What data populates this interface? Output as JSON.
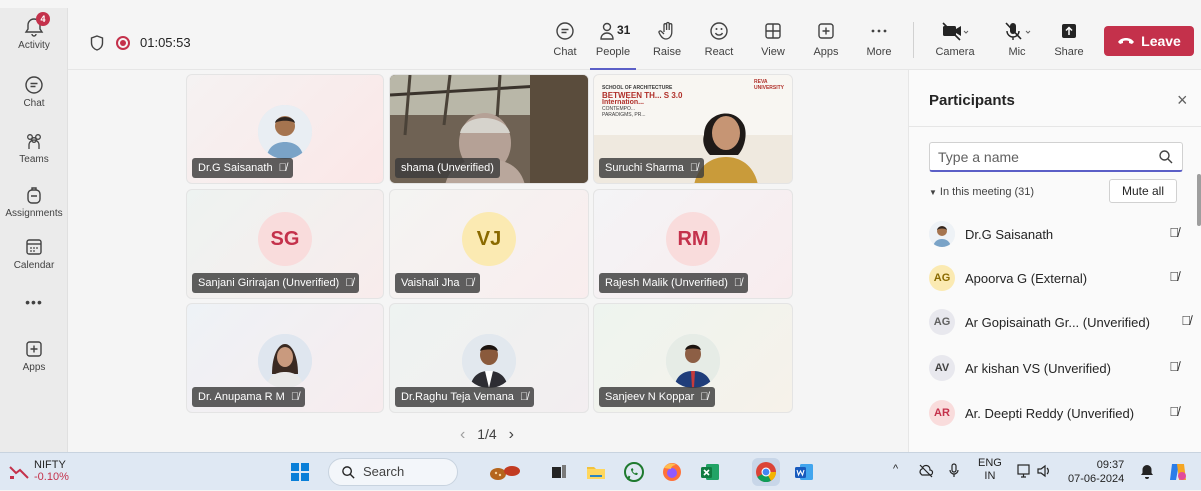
{
  "rail": {
    "activity": {
      "label": "Activity",
      "badge": "4"
    },
    "chat": "Chat",
    "teams": "Teams",
    "assignments": "Assignments",
    "calendar": "Calendar",
    "more": "•••",
    "apps": "Apps"
  },
  "meeting": {
    "timer": "01:05:53"
  },
  "toolbar": {
    "chat": "Chat",
    "people": "People",
    "people_count": "31",
    "raise": "Raise",
    "react": "React",
    "view": "View",
    "apps": "Apps",
    "more": "More",
    "camera": "Camera",
    "mic": "Mic",
    "share": "Share",
    "leave": "Leave"
  },
  "tiles": [
    {
      "name": "Dr.G Saisanath",
      "muted": true,
      "kind": "photo",
      "bg": "#f7e6e6"
    },
    {
      "name": "shama (Unverified)",
      "muted": false,
      "kind": "video"
    },
    {
      "name": "Suruchi Sharma",
      "muted": true,
      "kind": "video"
    },
    {
      "name": "Sanjani Girirajan (Unverified)",
      "muted": true,
      "kind": "initials",
      "initials": "SG",
      "color": "#c4314b",
      "avbg": "#f9dcdc"
    },
    {
      "name": "Vaishali Jha",
      "muted": true,
      "kind": "initials",
      "initials": "VJ",
      "color": "#8a6a00",
      "avbg": "#fbeab2"
    },
    {
      "name": "Rajesh Malik (Unverified)",
      "muted": true,
      "kind": "initials",
      "initials": "RM",
      "color": "#c4314b",
      "avbg": "#f9dcdc"
    },
    {
      "name": "Dr. Anupama R M",
      "muted": true,
      "kind": "photo"
    },
    {
      "name": "Dr.Raghu Teja Vemana",
      "muted": true,
      "kind": "photo"
    },
    {
      "name": "Sanjeev N Koppar",
      "muted": true,
      "kind": "photo"
    }
  ],
  "slide_text": {
    "org": "REVA UNIVERSITY",
    "school": "SCHOOL OF ARCHITECTURE",
    "headline": "BETWEEN TH... S 3.0",
    "sub": "Internation...",
    "line3": "CONTEMPO...",
    "line4": "PARADIGMS, PR..."
  },
  "pager": {
    "prev": "‹",
    "label": "1/4",
    "next": "›"
  },
  "panel": {
    "title": "Participants",
    "close": "×",
    "search_placeholder": "Type a name",
    "in_meeting": "In this meeting (31)",
    "mute_all": "Mute all",
    "participants": [
      {
        "initials": "",
        "name": "Dr.G Saisanath",
        "photo": true
      },
      {
        "initials": "AG",
        "name": "Apoorva G (External)",
        "bg": "#fbeab2",
        "fg": "#8a6a00"
      },
      {
        "initials": "AG",
        "name": "Ar Gopisainath Gr...  (Unverified)",
        "bg": "#e8e8ee",
        "fg": "#616161"
      },
      {
        "initials": "AV",
        "name": "Ar kishan VS (Unverified)",
        "bg": "#e8e8ee",
        "fg": "#424242"
      },
      {
        "initials": "AR",
        "name": "Ar. Deepti Reddy (Unverified)",
        "bg": "#f9dcdc",
        "fg": "#c4314b"
      }
    ]
  },
  "taskbar": {
    "ticker": "NIFTY",
    "ticker_change": "-0.10%",
    "search": "Search",
    "lang1": "ENG",
    "lang2": "IN",
    "time": "09:37",
    "date": "07-06-2024"
  }
}
